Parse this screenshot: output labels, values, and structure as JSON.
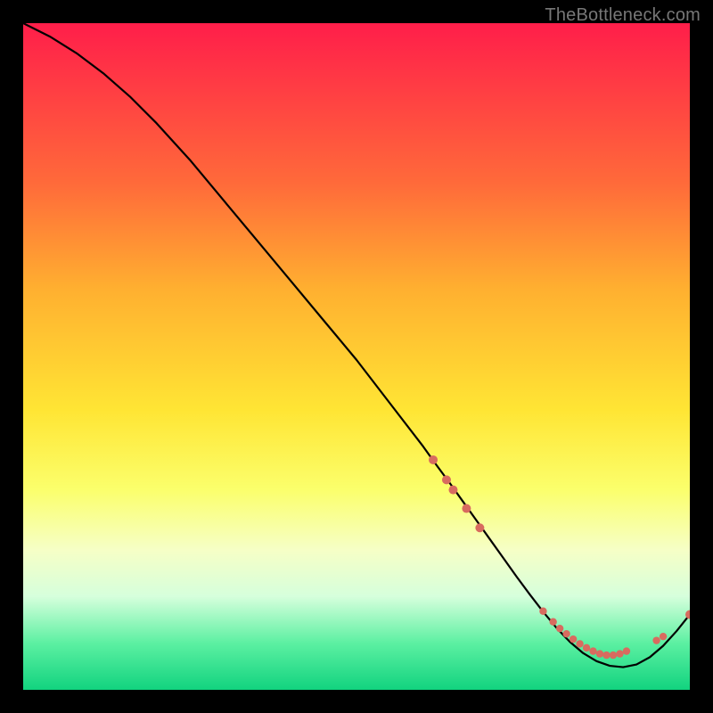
{
  "watermark": "TheBottleneck.com",
  "gradient": {
    "css_background": "linear-gradient(to bottom, #ff1e4a 0%, #ff6a3a 24%, #ffb030 40%, #ffe534 58%, #fbff6c 70%, #f6ffc6 79%, #d6ffdc 86%, #5cf0a2 93%, #12d37f 100%)",
    "stops": [
      {
        "offset": 0.0,
        "color": "#ff1e4a"
      },
      {
        "offset": 0.24,
        "color": "#ff6a3a"
      },
      {
        "offset": 0.4,
        "color": "#ffb030"
      },
      {
        "offset": 0.58,
        "color": "#ffe534"
      },
      {
        "offset": 0.7,
        "color": "#fbff6c"
      },
      {
        "offset": 0.79,
        "color": "#f6ffc6"
      },
      {
        "offset": 0.86,
        "color": "#d6ffdc"
      },
      {
        "offset": 0.93,
        "color": "#5cf0a2"
      },
      {
        "offset": 1.0,
        "color": "#12d37f"
      }
    ]
  },
  "chart_data": {
    "type": "line",
    "title": "",
    "xlabel": "",
    "ylabel": "",
    "xlim": [
      0,
      100
    ],
    "ylim": [
      0,
      100
    ],
    "grid": false,
    "legend": false,
    "series": [
      {
        "name": "curve",
        "x": [
          0,
          4,
          8,
          12,
          16,
          20,
          25,
          30,
          35,
          40,
          45,
          50,
          55,
          60,
          62,
          64,
          66,
          68,
          70,
          72,
          74,
          76,
          78,
          80,
          82,
          84,
          86,
          88,
          90,
          92,
          94,
          96,
          98,
          100
        ],
        "y": [
          100,
          98,
          95.5,
          92.5,
          89,
          85,
          79.5,
          73.5,
          67.5,
          61.5,
          55.5,
          49.5,
          43,
          36.5,
          33.7,
          31,
          28.2,
          25.4,
          22.6,
          19.8,
          17,
          14.3,
          11.7,
          9.3,
          7.2,
          5.5,
          4.3,
          3.6,
          3.4,
          3.8,
          4.9,
          6.6,
          8.8,
          11.3
        ]
      }
    ],
    "markers": [
      {
        "x": 61.5,
        "y": 34.5,
        "r": 5
      },
      {
        "x": 63.5,
        "y": 31.5,
        "r": 5
      },
      {
        "x": 64.5,
        "y": 30.0,
        "r": 5
      },
      {
        "x": 66.5,
        "y": 27.2,
        "r": 5
      },
      {
        "x": 68.5,
        "y": 24.3,
        "r": 5
      },
      {
        "x": 78.0,
        "y": 11.8,
        "r": 4.2
      },
      {
        "x": 79.5,
        "y": 10.2,
        "r": 4.2
      },
      {
        "x": 80.5,
        "y": 9.2,
        "r": 4.2
      },
      {
        "x": 81.5,
        "y": 8.4,
        "r": 4.2
      },
      {
        "x": 82.5,
        "y": 7.6,
        "r": 4.2
      },
      {
        "x": 83.5,
        "y": 6.9,
        "r": 4.2
      },
      {
        "x": 84.5,
        "y": 6.3,
        "r": 4.2
      },
      {
        "x": 85.5,
        "y": 5.8,
        "r": 4.2
      },
      {
        "x": 86.5,
        "y": 5.4,
        "r": 4.2
      },
      {
        "x": 87.5,
        "y": 5.2,
        "r": 4.2
      },
      {
        "x": 88.5,
        "y": 5.2,
        "r": 4.2
      },
      {
        "x": 89.5,
        "y": 5.4,
        "r": 4.2
      },
      {
        "x": 90.5,
        "y": 5.8,
        "r": 4.2
      },
      {
        "x": 95.0,
        "y": 7.4,
        "r": 4.2
      },
      {
        "x": 96.0,
        "y": 8.0,
        "r": 4.2
      },
      {
        "x": 100.0,
        "y": 11.3,
        "r": 5
      }
    ],
    "marker_color": "#d86b5f",
    "line_color": "#000000",
    "line_width": 2.2
  }
}
